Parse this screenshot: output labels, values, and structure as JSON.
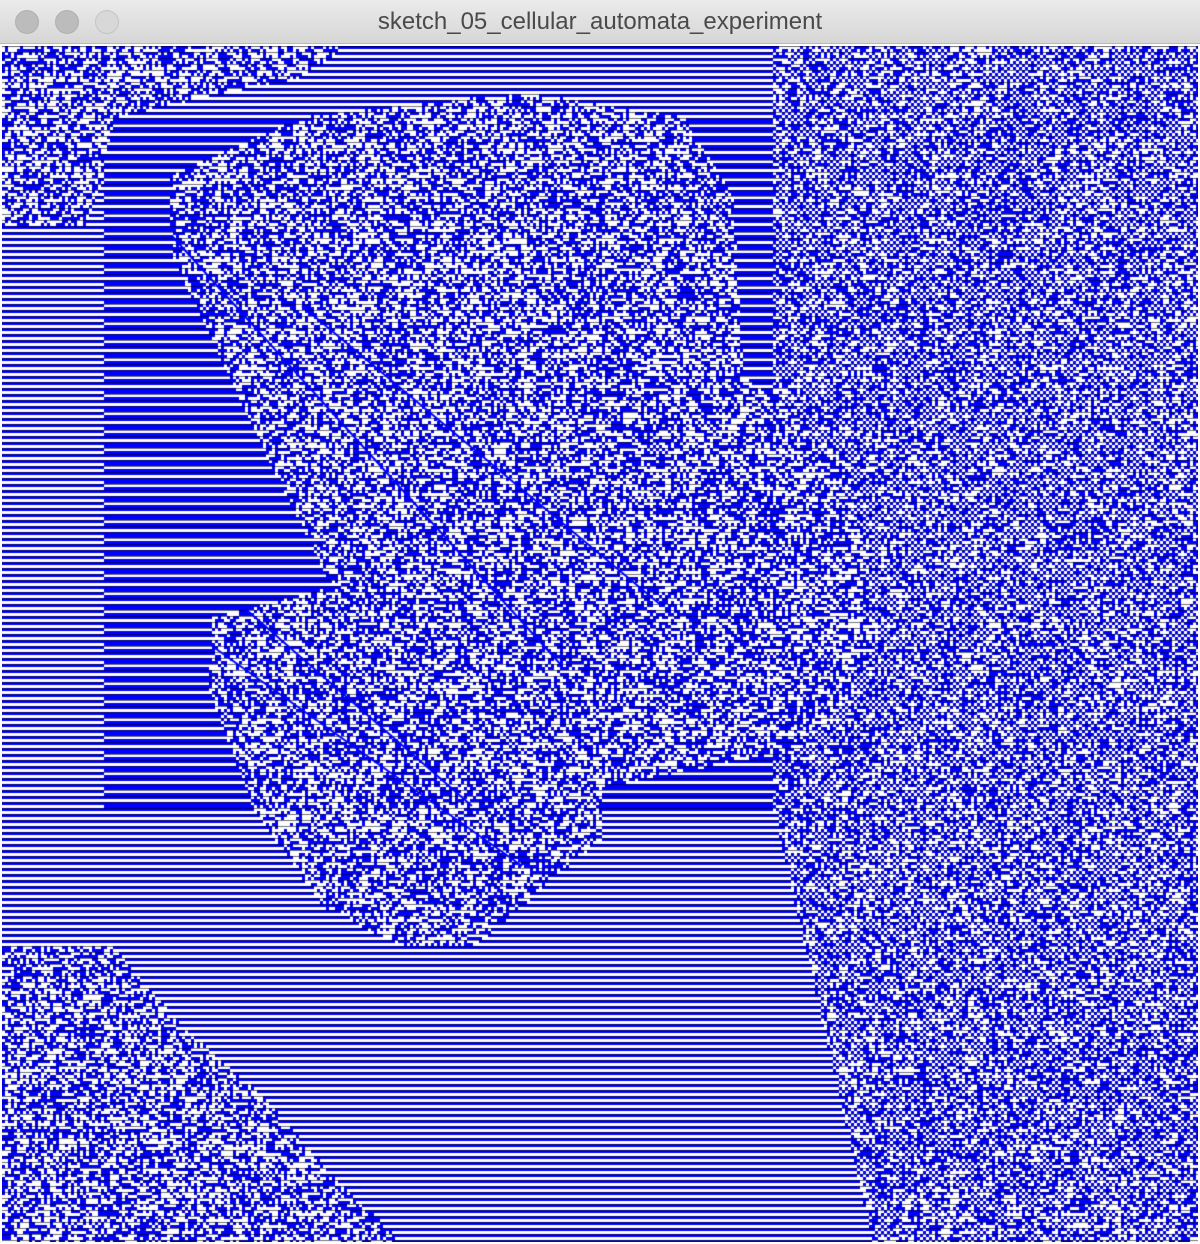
{
  "window": {
    "title": "sketch_05_cellular_automata_experiment"
  },
  "titlebar": {
    "buttons": [
      {
        "name": "close",
        "state": "inactive"
      },
      {
        "name": "minimize",
        "state": "inactive"
      },
      {
        "name": "zoom",
        "state": "disabled"
      }
    ]
  },
  "sketch": {
    "colors": {
      "cell_on": "#0000ff",
      "cell_off": "#ffffff",
      "line_dark": "#000000"
    }
  }
}
